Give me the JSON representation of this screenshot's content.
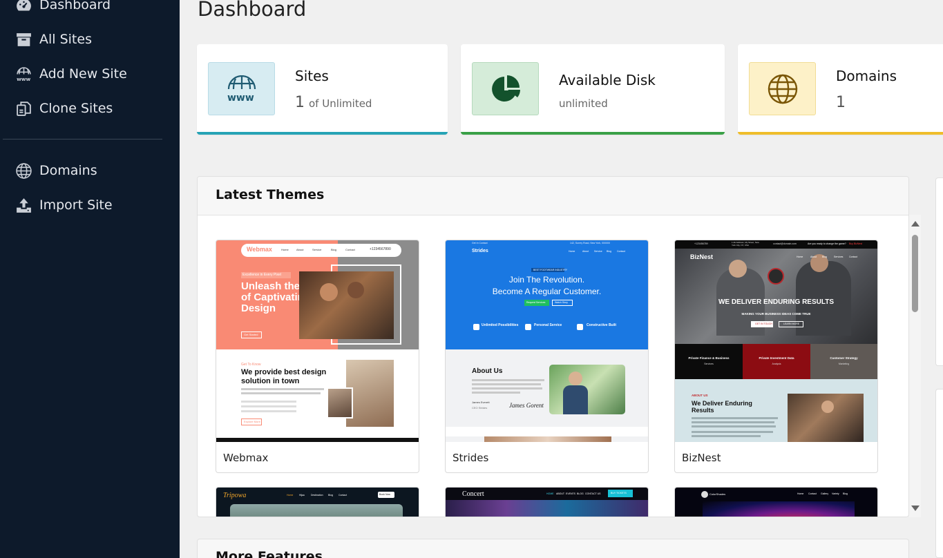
{
  "sidebar": {
    "items": [
      {
        "label": "Dashboard",
        "icon": "dashboard-icon"
      },
      {
        "label": "All Sites",
        "icon": "archive-box-icon"
      },
      {
        "label": "Add New Site",
        "icon": "www-icon"
      },
      {
        "label": "Clone Sites",
        "icon": "clone-icon"
      },
      {
        "label": "Domains",
        "icon": "globe-icon"
      },
      {
        "label": "Import Site",
        "icon": "upload-icon"
      }
    ]
  },
  "page": {
    "title": "Dashboard"
  },
  "stats": [
    {
      "title": "Sites",
      "value": "1",
      "suffix": "of Unlimited",
      "color": "#26a3b5",
      "icon_bg": "#d7ecf2",
      "icon": "www-globe-icon"
    },
    {
      "title": "Available Disk",
      "value": "",
      "suffix": "unlimited",
      "color": "#3aa047",
      "icon_bg": "#d5ecd9",
      "icon": "pie-chart-icon"
    },
    {
      "title": "Domains",
      "value": "1",
      "suffix": "",
      "color": "#efbd2b",
      "icon_bg": "#fdf1c8",
      "icon": "globe-icon"
    }
  ],
  "themes": {
    "title": "Latest Themes",
    "items": [
      {
        "name": "Webmax"
      },
      {
        "name": "Strides"
      },
      {
        "name": "BizNest"
      }
    ]
  },
  "features": {
    "title": "More Features"
  },
  "thumbs": {
    "webmax": {
      "brand": "Webmax",
      "nav": [
        "Home",
        "About",
        "Service",
        "Blog",
        "Contact"
      ],
      "phone": "+1234567890",
      "tag": "Excellence in Every Pixel",
      "headline": "Unleash the Power of Captivating Design",
      "cta": "Get Started",
      "section_tag": "Get To Know",
      "section_title": "We provide best design solution in town",
      "section_cta": "Explore More"
    },
    "strides": {
      "brand": "Strides",
      "top": "Get In Contact",
      "address": "142, Surrey Road, New York, 000000",
      "nav": [
        "Home",
        "About",
        "Service",
        "Blog",
        "Contact"
      ],
      "tag": "BEST FOOTWEAR INDUSTRY",
      "headline1": "Join The Revolution.",
      "headline2": "Become A Regular Customer.",
      "btn1": "Request Services",
      "btn2": "Watch Story",
      "features": [
        "Unlimited Possibilities",
        "Personal Service",
        "Constructive Built"
      ],
      "about": "About Us",
      "person": "James Everett",
      "role": "CEO Strides",
      "signature": "James Gorent"
    },
    "biznest": {
      "brand": "BizNest",
      "phone": "+123456789",
      "address": "1 Ab Address, My Street, New York City, NY, USA",
      "email": "contact@domain.com",
      "cta_top": "Are you ready to change the game?",
      "cta_top_link": "Buy BizNest",
      "nav": [
        "Home",
        "About",
        "Blog",
        "Services",
        "Contact"
      ],
      "headline": "WE DELIVER ENDURING RESULTS",
      "sub": "MAKING YOUR BUSINESS IDEAS COME TRUE",
      "btn1": "GET IN TOUCH",
      "btn2": "LEARN MORE",
      "tiles": [
        {
          "title": "Private Finance & Business",
          "sub": "Services"
        },
        {
          "title": "Private Investment Data",
          "sub": "Analysis"
        },
        {
          "title": "Customer Strategy",
          "sub": "Marketing"
        }
      ],
      "about_tag": "ABOUT US",
      "about_title": "We Deliver Enduring Results"
    },
    "tripowa": {
      "brand": "Tripowa",
      "nav": [
        "Home",
        "Hijau",
        "Destination",
        "Blog",
        "Contact"
      ],
      "btn": "Book Now"
    },
    "concert": {
      "brand": "Concert",
      "nav": [
        "HOME",
        "ABOUT",
        "EVENTS",
        "BLOG",
        "CONTACT US"
      ],
      "btn": "BUY TICKETS"
    },
    "colorshades": {
      "brand": "ColorShades",
      "nav": [
        "Home",
        "Contact",
        "Gallery",
        "Variety",
        "Blog"
      ]
    }
  }
}
